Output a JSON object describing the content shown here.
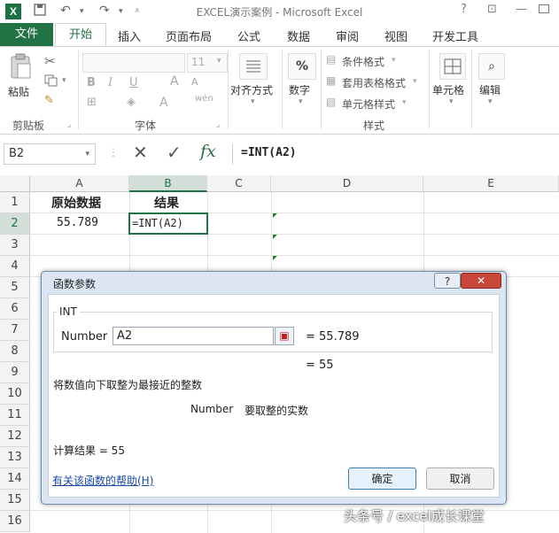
{
  "window": {
    "title": "EXCEL演示案例 - Microsoft Excel",
    "help": "?",
    "restore": "⊡",
    "minimize": "—"
  },
  "ribbon": {
    "tabs": [
      "文件",
      "开始",
      "插入",
      "页面布局",
      "公式",
      "数据",
      "审阅",
      "视图",
      "开发工具"
    ],
    "clipboard": {
      "paste": "粘贴",
      "group": "剪贴板"
    },
    "font": {
      "size": "11",
      "bold": "B",
      "italic": "I",
      "underline": "U",
      "group": "字体",
      "grow": "A",
      "shrink": "A",
      "color": "A"
    },
    "alignment": {
      "label": "对齐方式"
    },
    "number": {
      "label": "数字",
      "symbol": "%"
    },
    "styles": {
      "conditional": "条件格式",
      "table": "套用表格格式",
      "cell": "单元格样式",
      "group": "样式"
    },
    "cells": {
      "label": "单元格"
    },
    "editing": {
      "label": "编辑"
    }
  },
  "formula_bar": {
    "name_box": "B2",
    "cancel": "✕",
    "enter": "✓",
    "fx": "fx",
    "formula": "=INT(A2)"
  },
  "sheet": {
    "columns": [
      "A",
      "B",
      "C",
      "D",
      "E"
    ],
    "rows": [
      "1",
      "2",
      "3",
      "4",
      "5",
      "6",
      "7",
      "8",
      "9",
      "10",
      "11",
      "12",
      "13",
      "14",
      "15",
      "16"
    ],
    "a1": "原始数据",
    "b1": "结果",
    "a2": "55.789",
    "b2": "=INT(A2)"
  },
  "dialog": {
    "title": "函数参数",
    "function_name": "INT",
    "arg_label": "Number",
    "arg_value": "A2",
    "arg_result": "=  55.789",
    "result": "=  55",
    "description": "将数值向下取整为最接近的整数",
    "arg_desc_name": "Number",
    "arg_desc": "要取整的实数",
    "calc_result": "计算结果 =   55",
    "help_link": "有关该函数的帮助(H)",
    "ok": "确定",
    "cancel": "取消"
  },
  "watermark": "头条号 / excel成长课堂"
}
